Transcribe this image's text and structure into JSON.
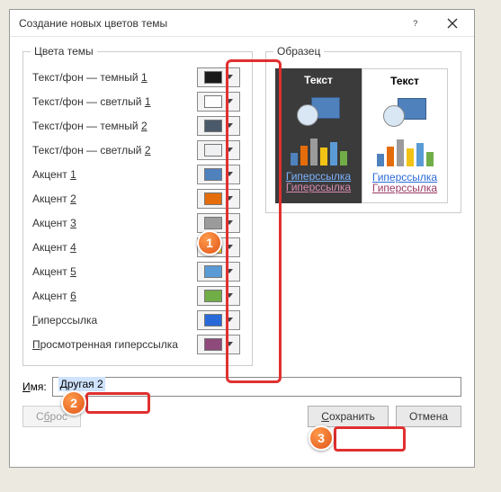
{
  "title": "Создание новых цветов темы",
  "groups": {
    "theme_colors": "Цвета темы",
    "sample": "Образец"
  },
  "rows": [
    {
      "label_pre": "Текст/фон — темный ",
      "key": "1",
      "label_post": "",
      "color": "#1a1a1a"
    },
    {
      "label_pre": "Текст/фон — светлый ",
      "key": "1",
      "label_post": "",
      "color": "#ffffff"
    },
    {
      "label_pre": "Текст/фон — темный ",
      "key": "2",
      "label_post": "",
      "color": "#4a5a6a"
    },
    {
      "label_pre": "Текст/фон — светлый ",
      "key": "2",
      "label_post": "",
      "color": "#eef0f2"
    },
    {
      "label_pre": "Акцент ",
      "key": "1",
      "label_post": "",
      "color": "#4f81bd"
    },
    {
      "label_pre": "Акцент ",
      "key": "2",
      "label_post": "",
      "color": "#e46c0a"
    },
    {
      "label_pre": "Акцент ",
      "key": "3",
      "label_post": "",
      "color": "#9b9b9b"
    },
    {
      "label_pre": "Акцент ",
      "key": "4",
      "label_post": "",
      "color": "#f2c314"
    },
    {
      "label_pre": "Акцент ",
      "key": "5",
      "label_post": "",
      "color": "#5b9bd5"
    },
    {
      "label_pre": "Акцент ",
      "key": "6",
      "label_post": "",
      "color": "#70ad47"
    },
    {
      "label_pre": "",
      "key": "Г",
      "label_post": "иперссылка",
      "color": "#2a6ad8"
    },
    {
      "label_pre": "",
      "key": "П",
      "label_post": "росмотренная гиперссылка",
      "color": "#8d4a7a"
    }
  ],
  "sample_text": {
    "text": "Текст",
    "hyperlink": "Гиперссылка",
    "visited": "Гиперссылка"
  },
  "bar_colors": [
    "#4f81bd",
    "#e46c0a",
    "#9b9b9b",
    "#f2c314",
    "#5b9bd5",
    "#70ad47"
  ],
  "name": {
    "label_pre": "",
    "key": "И",
    "label_post": "мя:",
    "value": "Другая 2"
  },
  "buttons": {
    "reset_pre": "С",
    "reset_key": "б",
    "reset_post": "рос",
    "save_pre": "",
    "save_key": "С",
    "save_post": "охранить",
    "cancel": "Отмена"
  },
  "badges": {
    "b1": "1",
    "b2": "2",
    "b3": "3"
  }
}
